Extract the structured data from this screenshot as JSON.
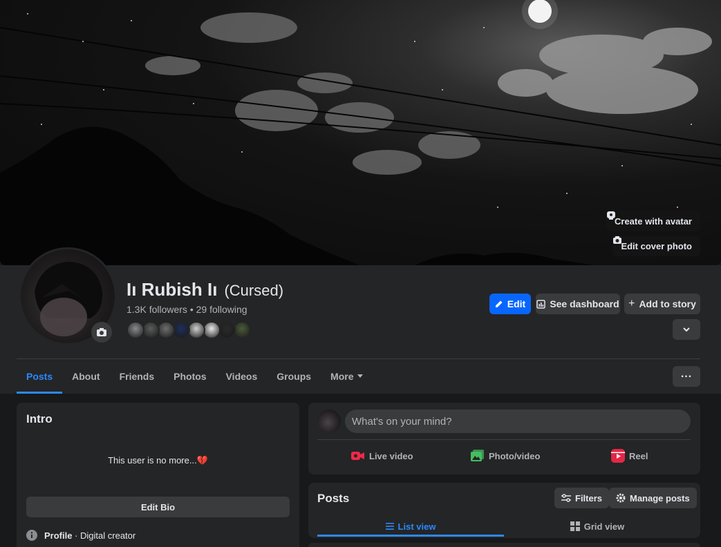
{
  "cover": {
    "create_avatar_label": "Create with avatar",
    "edit_cover_label": "Edit cover photo"
  },
  "profile": {
    "name": "Iı Rubish Iı",
    "alternate_name": "(Cursed)",
    "followers_text": "1.3K followers • 29 following"
  },
  "actions": {
    "edit_label": "Edit",
    "dashboard_label": "See dashboard",
    "add_story_label": "Add to story"
  },
  "tabs": [
    {
      "label": "Posts"
    },
    {
      "label": "About"
    },
    {
      "label": "Friends"
    },
    {
      "label": "Photos"
    },
    {
      "label": "Videos"
    },
    {
      "label": "Groups"
    },
    {
      "label": "More"
    }
  ],
  "intro": {
    "title": "Intro",
    "bio": "This user is no more...",
    "bio_emoji": "💔",
    "edit_bio_label": "Edit Bio",
    "profile_label": "Profile",
    "profile_category": " · Digital creator"
  },
  "composer": {
    "placeholder": "What's on your mind?",
    "live_video": "Live video",
    "photo_video": "Photo/video",
    "reel": "Reel"
  },
  "posts": {
    "title": "Posts",
    "filters_label": "Filters",
    "manage_label": "Manage posts",
    "list_view": "List view",
    "grid_view": "Grid view"
  },
  "colors": {
    "accent": "#0866ff",
    "active_tab": "#2d88ff",
    "live_icon": "#f02849",
    "photo_icon": "#45bd62",
    "reel_icon": "#e42645"
  },
  "friend_avatar_colors": [
    "#8a8a8a",
    "#5c5c5c",
    "#6e6e6e",
    "#1f2e5a",
    "#cfcfcf",
    "#e8e8e8",
    "#2a2a2a",
    "#4a5a3a"
  ]
}
